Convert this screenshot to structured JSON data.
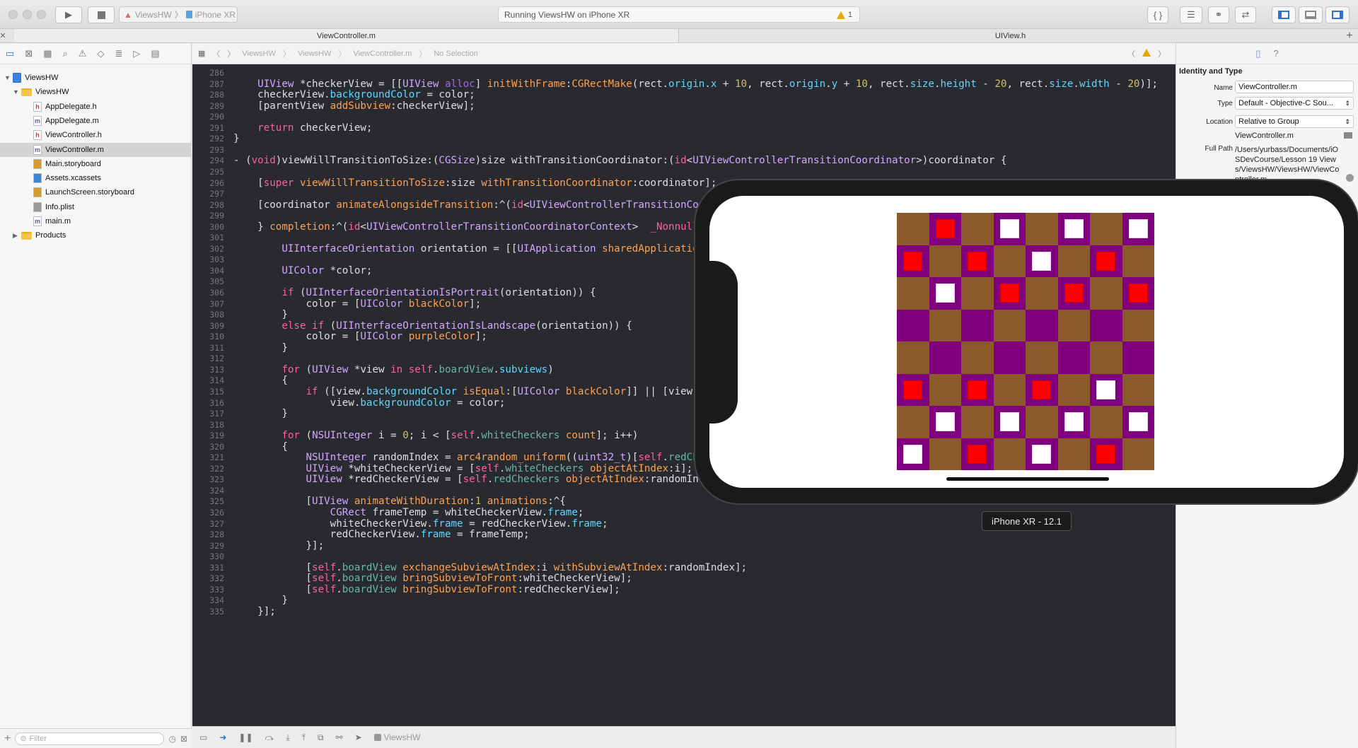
{
  "toolbar": {
    "scheme_name": "ViewsHW",
    "device_name": "iPhone XR",
    "activity_text": "Running ViewsHW on iPhone XR",
    "warning_count": "1"
  },
  "tabs": [
    {
      "label": "ViewController.m"
    },
    {
      "label": "UIView.h"
    }
  ],
  "navigator": {
    "items": [
      {
        "label": "ViewsHW",
        "kind": "project"
      },
      {
        "label": "ViewsHW",
        "kind": "folder"
      },
      {
        "label": "AppDelegate.h",
        "kind": "h"
      },
      {
        "label": "AppDelegate.m",
        "kind": "m"
      },
      {
        "label": "ViewController.h",
        "kind": "h"
      },
      {
        "label": "ViewController.m",
        "kind": "m",
        "selected": true
      },
      {
        "label": "Main.storyboard",
        "kind": "storyboard"
      },
      {
        "label": "Assets.xcassets",
        "kind": "assets"
      },
      {
        "label": "LaunchScreen.storyboard",
        "kind": "storyboard"
      },
      {
        "label": "Info.plist",
        "kind": "plist"
      },
      {
        "label": "main.m",
        "kind": "m"
      },
      {
        "label": "Products",
        "kind": "folder"
      }
    ],
    "filter_placeholder": "Filter"
  },
  "jumpbar": {
    "crumbs": [
      "ViewsHW",
      "ViewsHW",
      "ViewController.m",
      "No Selection"
    ]
  },
  "editor": {
    "lines": [
      {
        "n": "286",
        "html": ""
      },
      {
        "n": "287",
        "html": "    <span class=\"ty\">UIView</span> *checkerView = [[<span class=\"ty\">UIView</span> <span class=\"fn\">alloc</span>] <span class=\"cl\">initWithFrame</span>:<span class=\"cl\">CGRectMake</span>(rect.<span class=\"pr\">origin</span>.<span class=\"pr\">x</span> + <span class=\"nb\">10</span>, rect.<span class=\"pr\">origin</span>.<span class=\"pr\">y</span> + <span class=\"nb\">10</span>, rect.<span class=\"pr\">size</span>.<span class=\"pr\">height</span> - <span class=\"nb\">20</span>, rect.<span class=\"pr\">size</span>.<span class=\"pr\">width</span> - <span class=\"nb\">20</span>)];"
      },
      {
        "n": "288",
        "html": "    checkerView.<span class=\"pr\">backgroundColor</span> = color;"
      },
      {
        "n": "289",
        "html": "    [parentView <span class=\"cl\">addSubview</span>:checkerView];"
      },
      {
        "n": "290",
        "html": ""
      },
      {
        "n": "291",
        "html": "    <span class=\"kw\">return</span> checkerView;"
      },
      {
        "n": "292",
        "html": "}"
      },
      {
        "n": "293",
        "html": ""
      },
      {
        "n": "294",
        "html": "- (<span class=\"kw\">void</span>)viewWillTransitionToSize:(<span class=\"ty\">CGSize</span>)size withTransitionCoordinator:(<span class=\"kw\">id</span>&lt;<span class=\"ty\">UIViewControllerTransitionCoordinator</span>&gt;)coordinator {"
      },
      {
        "n": "295",
        "html": ""
      },
      {
        "n": "296",
        "html": "    [<span class=\"kw\">super</span> <span class=\"cl\">viewWillTransitionToSize</span>:size <span class=\"cl\">withTransitionCoordinator</span>:coordinator];"
      },
      {
        "n": "297",
        "html": ""
      },
      {
        "n": "298",
        "html": "    [coordinator <span class=\"cl\">animateAlongsideTransition</span>:^(<span class=\"kw\">id</span>&lt;<span class=\"ty\">UIViewControllerTransitionCoordinatorContext</span>&gt;  <span class=\"kw\">_Nonnull</span> context) {"
      },
      {
        "n": "299",
        "html": ""
      },
      {
        "n": "300",
        "html": "    } <span class=\"cl\">completion</span>:^(<span class=\"kw\">id</span>&lt;<span class=\"ty\">UIViewControllerTransitionCoordinatorContext</span>&gt;  <span class=\"kw\">_Nonnull</span> context) {"
      },
      {
        "n": "301",
        "html": ""
      },
      {
        "n": "302",
        "html": "        <span class=\"ty\">UIInterfaceOrientation</span> orientation = [[<span class=\"ty\">UIApplication</span> <span class=\"cl\">sharedApplication</span>] <span class=\"cl\">statusBarOrientation</span>];"
      },
      {
        "n": "303",
        "html": ""
      },
      {
        "n": "304",
        "html": "        <span class=\"ty\">UIColor</span> *color;"
      },
      {
        "n": "305",
        "html": ""
      },
      {
        "n": "306",
        "html": "        <span class=\"kw\">if</span> (<span class=\"ty\">UIInterfaceOrientationIsPortrait</span>(orientation)) {"
      },
      {
        "n": "307",
        "html": "            color = [<span class=\"ty\">UIColor</span> <span class=\"cl\">blackColor</span>];"
      },
      {
        "n": "308",
        "html": "        }"
      },
      {
        "n": "309",
        "html": "        <span class=\"kw\">else if</span> (<span class=\"ty\">UIInterfaceOrientationIsLandscape</span>(orientation)) {"
      },
      {
        "n": "310",
        "html": "            color = [<span class=\"ty\">UIColor</span> <span class=\"cl\">purpleColor</span>];"
      },
      {
        "n": "311",
        "html": "        }"
      },
      {
        "n": "312",
        "html": ""
      },
      {
        "n": "313",
        "html": "        <span class=\"kw\">for</span> (<span class=\"ty\">UIView</span> *view <span class=\"kw\">in</span> <span class=\"kw\">self</span>.<span class=\"mm\">boardView</span>.<span class=\"pr\">subviews</span>)"
      },
      {
        "n": "314",
        "html": "        {"
      },
      {
        "n": "315",
        "html": "            <span class=\"kw\">if</span> ([view.<span class=\"pr\">backgroundColor</span> <span class=\"cl\">isEqual</span>:[<span class=\"ty\">UIColor</span> <span class=\"cl\">blackColor</span>]] || [view.<span class=\"pr\">backgroundColor</span> <span class=\"cl\">isEqual</span>:[<span class=\"ty\">UIColor</span> <span class=\"cl\">purpleColor</span>]])"
      },
      {
        "n": "316",
        "html": "                view.<span class=\"pr\">backgroundColor</span> = color;"
      },
      {
        "n": "317",
        "html": "        }"
      },
      {
        "n": "318",
        "html": ""
      },
      {
        "n": "319",
        "html": "        <span class=\"kw\">for</span> (<span class=\"ty\">NSUInteger</span> i = <span class=\"nb\">0</span>; i &lt; [<span class=\"kw\">self</span>.<span class=\"mm\">whiteCheckers</span> <span class=\"cl\">count</span>]; i++)"
      },
      {
        "n": "320",
        "html": "        {"
      },
      {
        "n": "321",
        "html": "            <span class=\"ty\">NSUInteger</span> randomIndex = <span class=\"cl\">arc4random_uniform</span>((<span class=\"ty\">uint32_t</span>)[<span class=\"kw\">self</span>.<span class=\"mm\">redCheckers</span> <span class=\"cl\">count</span>]);"
      },
      {
        "n": "322",
        "html": "            <span class=\"ty\">UIView</span> *whiteCheckerView = [<span class=\"kw\">self</span>.<span class=\"mm\">whiteCheckers</span> <span class=\"cl\">objectAtIndex</span>:i];"
      },
      {
        "n": "323",
        "html": "            <span class=\"ty\">UIView</span> *redCheckerView = [<span class=\"kw\">self</span>.<span class=\"mm\">redCheckers</span> <span class=\"cl\">objectAtIndex</span>:randomIndex];"
      },
      {
        "n": "324",
        "html": ""
      },
      {
        "n": "325",
        "html": "            [<span class=\"ty\">UIView</span> <span class=\"cl\">animateWithDuration</span>:<span class=\"nb\">1</span> <span class=\"cl\">animations</span>:^{"
      },
      {
        "n": "326",
        "html": "                <span class=\"ty\">CGRect</span> frameTemp = whiteCheckerView.<span class=\"pr\">frame</span>;"
      },
      {
        "n": "327",
        "html": "                whiteCheckerView.<span class=\"pr\">frame</span> = redCheckerView.<span class=\"pr\">frame</span>;"
      },
      {
        "n": "328",
        "html": "                redCheckerView.<span class=\"pr\">frame</span> = frameTemp;"
      },
      {
        "n": "329",
        "html": "            }];"
      },
      {
        "n": "330",
        "html": ""
      },
      {
        "n": "331",
        "html": "            [<span class=\"kw\">self</span>.<span class=\"mm\">boardView</span> <span class=\"cl\">exchangeSubviewAtIndex</span>:i <span class=\"cl\">withSubviewAtIndex</span>:randomIndex];"
      },
      {
        "n": "332",
        "html": "            [<span class=\"kw\">self</span>.<span class=\"mm\">boardView</span> <span class=\"cl\">bringSubviewToFront</span>:whiteCheckerView];"
      },
      {
        "n": "333",
        "html": "            [<span class=\"kw\">self</span>.<span class=\"mm\">boardView</span> <span class=\"cl\">bringSubviewToFront</span>:redCheckerView];"
      },
      {
        "n": "334",
        "html": "        }"
      },
      {
        "n": "335",
        "html": "    }];"
      }
    ]
  },
  "inspector": {
    "section_title": "Identity and Type",
    "name_label": "Name",
    "name_value": "ViewController.m",
    "type_label": "Type",
    "type_value": "Default - Objective-C Sou...",
    "location_label": "Location",
    "location_value": "Relative to Group",
    "location_file": "ViewController.m",
    "fullpath_label": "Full Path",
    "fullpath_value": "/Users/yurbass/Documents/iOSDevCourse/Lesson 19 Views/ViewsHW/ViewsHW/ViewController.m"
  },
  "debugbar": {
    "target": "ViewsHW"
  },
  "simulator": {
    "label": "iPhone XR - 12.1",
    "colors": {
      "brown": "#8b5a2b",
      "purple": "#800080",
      "red": "#ff0000",
      "white": "#ffffff"
    },
    "board": [
      [
        "",
        "R",
        "",
        "W",
        "",
        "W",
        "",
        "W"
      ],
      [
        "R",
        "",
        "R",
        "",
        "W",
        "",
        "R",
        ""
      ],
      [
        "",
        "W",
        "",
        "R",
        "",
        "R",
        "",
        "R"
      ],
      [
        "",
        "",
        "",
        "",
        "",
        "",
        "",
        ""
      ],
      [
        "",
        "",
        "",
        "",
        "",
        "",
        "",
        ""
      ],
      [
        "R",
        "",
        "R",
        "",
        "R",
        "",
        "W",
        ""
      ],
      [
        "",
        "W",
        "",
        "W",
        "",
        "W",
        "",
        "W"
      ],
      [
        "W",
        "",
        "R",
        "",
        "W",
        "",
        "R",
        ""
      ]
    ]
  }
}
